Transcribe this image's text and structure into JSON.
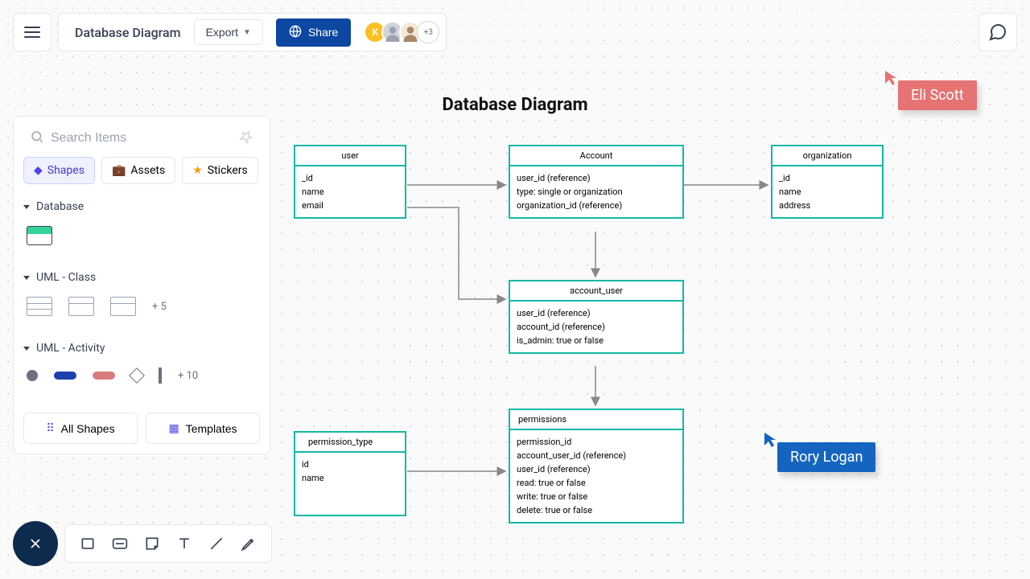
{
  "header": {
    "title": "Database Diagram",
    "export": "Export",
    "share": "Share",
    "avatar_k": "K",
    "avatar_count": "+3"
  },
  "sidebar": {
    "search_placeholder": "Search Items",
    "tabs": {
      "shapes": "Shapes",
      "assets": "Assets",
      "stickers": "Stickers"
    },
    "sections": {
      "database": "Database",
      "uml_class": "UML - Class",
      "uml_class_more": "+ 5",
      "uml_activity": "UML - Activity",
      "uml_activity_more": "+ 10"
    },
    "buttons": {
      "all_shapes": "All Shapes",
      "templates": "Templates"
    }
  },
  "canvas": {
    "title": "Database Diagram",
    "tables": {
      "user": {
        "name": "user",
        "fields": [
          "_id",
          "name",
          "email"
        ]
      },
      "account": {
        "name": "Account",
        "fields": [
          "user_id (reference)",
          "type: single or organization",
          "organization_id (reference)"
        ]
      },
      "organization": {
        "name": "organization",
        "fields": [
          "_id",
          "name",
          "address"
        ]
      },
      "account_user": {
        "name": "account_user",
        "fields": [
          "user_id (reference)",
          "account_id (reference)",
          "is_admin: true or false"
        ]
      },
      "permissions": {
        "name": "permissions",
        "fields": [
          "permission_id",
          "account_user_id (reference)",
          "user_id (reference)",
          "read: true or false",
          "write: true or false",
          "delete: true or false"
        ]
      },
      "permission_type": {
        "name": "permission_type",
        "fields": [
          "id",
          "name"
        ]
      }
    }
  },
  "cursors": {
    "eli": "Eli Scott",
    "rory": "Rory Logan"
  }
}
